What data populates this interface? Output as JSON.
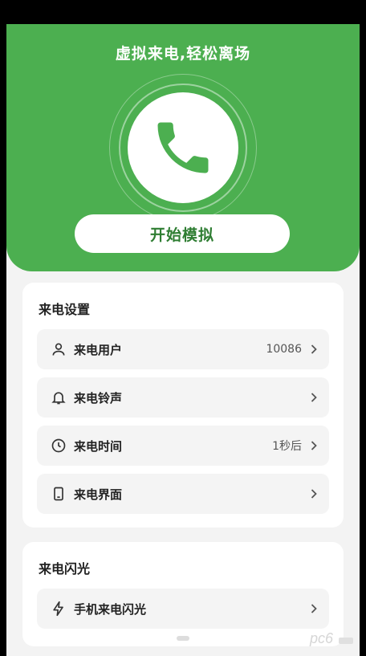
{
  "hero": {
    "title": "虚拟来电,轻松离场",
    "start_button": "开始模拟",
    "phone_icon": "phone-icon",
    "accent_color": "#4caf50"
  },
  "call_settings": {
    "title": "来电设置",
    "items": [
      {
        "icon": "user-icon",
        "label": "来电用户",
        "value": "10086"
      },
      {
        "icon": "bell-icon",
        "label": "来电铃声",
        "value": ""
      },
      {
        "icon": "clock-icon",
        "label": "来电时间",
        "value": "1秒后"
      },
      {
        "icon": "screen-icon",
        "label": "来电界面",
        "value": ""
      }
    ]
  },
  "flash": {
    "title": "来电闪光",
    "items": [
      {
        "icon": "lightning-icon",
        "label": "手机来电闪光",
        "value": ""
      }
    ]
  },
  "watermark": {
    "text": "pc6",
    "icon": "pc6-watermark-icon"
  }
}
